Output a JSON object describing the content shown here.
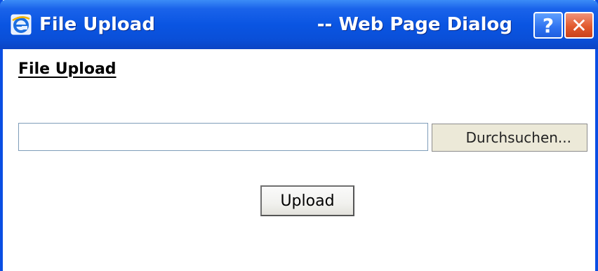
{
  "window": {
    "title": "File Upload",
    "title_suffix": "-- Web Page Dialog",
    "help_button_label": "?",
    "close_button_label": "✕",
    "icon": "internet-explorer-icon"
  },
  "content": {
    "heading": "File Upload",
    "file_input_value": "",
    "browse_button_label": "Durchsuchen...",
    "upload_button_label": "Upload"
  },
  "colors": {
    "titlebar_blue": "#0a55e2",
    "close_red": "#e25a2e",
    "button_face": "#ece9d8"
  }
}
